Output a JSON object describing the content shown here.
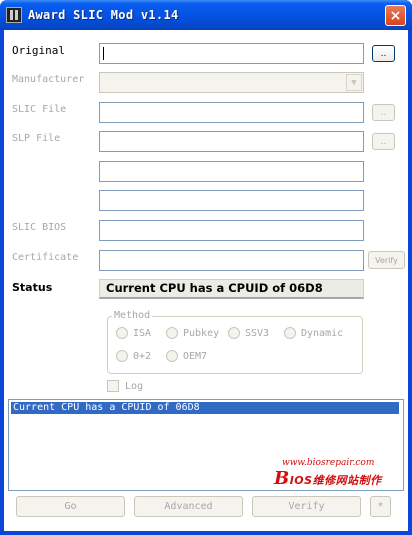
{
  "window": {
    "title": "Award SLIC Mod v1.14",
    "close_glyph": "×"
  },
  "labels": {
    "original": "Original",
    "manufacturer": "Manufacturer",
    "slic_file": "SLIC File",
    "slp_file": "SLP File",
    "slic_bios": "SLIC BIOS",
    "certificate": "Certificate",
    "status": "Status"
  },
  "fields": {
    "original_value": "",
    "slic_file_value": "",
    "slp_file_value": "",
    "extra1_value": "",
    "extra2_value": "",
    "slic_bios_value": "",
    "certificate_value": ""
  },
  "buttons": {
    "browse": "..",
    "verify_small": "Verify",
    "go": "Go",
    "advanced": "Advanced",
    "verify": "Verify",
    "extra": "*"
  },
  "status_text": "Current CPU has a CPUID of 06D8",
  "method": {
    "title": "Method",
    "options": [
      "ISA",
      "Pubkey",
      "SSV3",
      "Dynamic",
      "0+2",
      "OEM7"
    ]
  },
  "log": {
    "label": "Log",
    "lines": [
      "Current CPU has a CPUID of 06D8"
    ]
  },
  "watermark": {
    "url": "www.biosrepair.com",
    "brand_letter": "B",
    "brand_text": "IOS维修网站制作"
  },
  "icons": {
    "app": "app-icon",
    "close": "close-icon",
    "dropdown": "chevron-down-icon"
  }
}
